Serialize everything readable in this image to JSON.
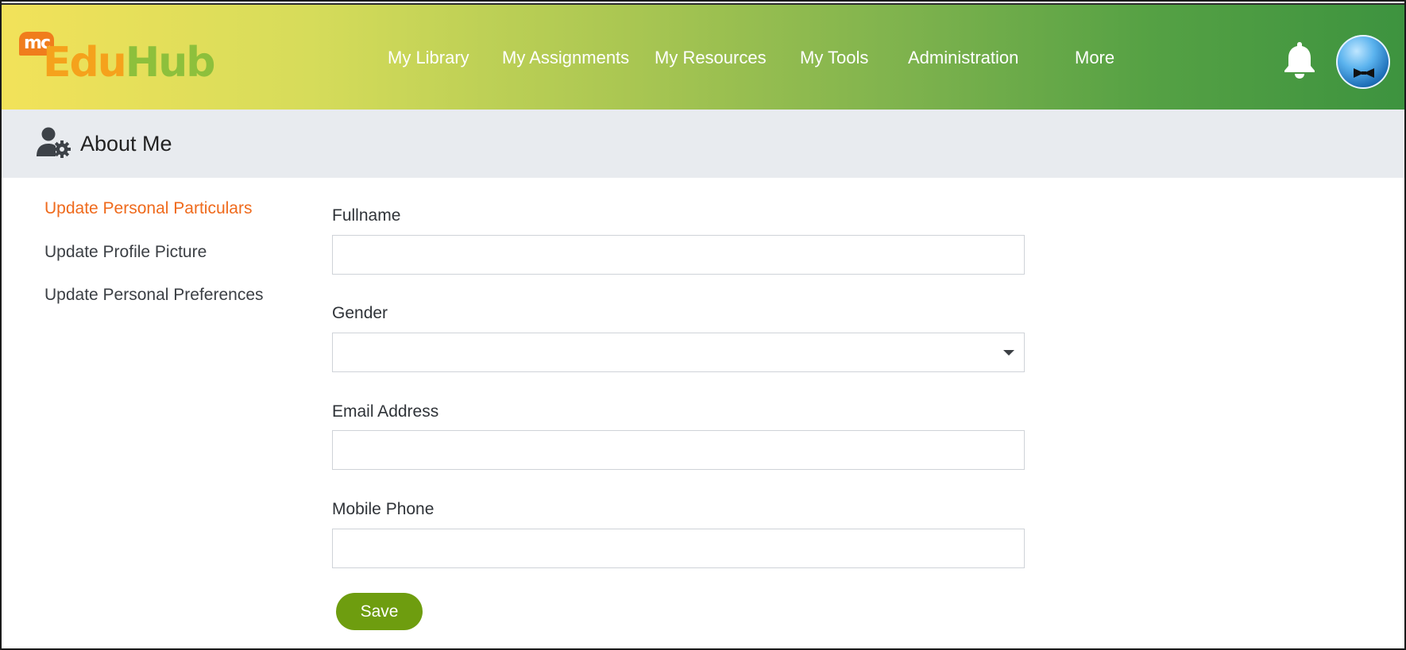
{
  "header": {
    "logo_badge": "mc",
    "logo_part1": "Edu",
    "logo_part2": "Hub",
    "nav": [
      {
        "label": "My Library"
      },
      {
        "label": "My Assignments"
      },
      {
        "label": "My Resources"
      },
      {
        "label": "My Tools"
      },
      {
        "label": "Administration"
      },
      {
        "label": "More"
      }
    ],
    "notification_icon": "bell-icon",
    "avatar_icon": "user-avatar"
  },
  "page": {
    "title": "About Me",
    "title_icon": "user-settings-icon"
  },
  "sidebar": {
    "items": [
      {
        "label": "Update Personal Particulars",
        "active": true
      },
      {
        "label": "Update Profile Picture",
        "active": false
      },
      {
        "label": "Update Personal Preferences",
        "active": false
      }
    ]
  },
  "form": {
    "fullname": {
      "label": "Fullname",
      "value": ""
    },
    "gender": {
      "label": "Gender",
      "value": ""
    },
    "email": {
      "label": "Email Address",
      "value": ""
    },
    "mobile": {
      "label": "Mobile Phone",
      "value": ""
    },
    "save_label": "Save"
  },
  "colors": {
    "active_link": "#ef6a1c",
    "save_button": "#6e9d0f",
    "header_gradient_start": "#f2e25a",
    "header_gradient_end": "#3d933f",
    "titlebar_bg": "#e8ebef"
  }
}
